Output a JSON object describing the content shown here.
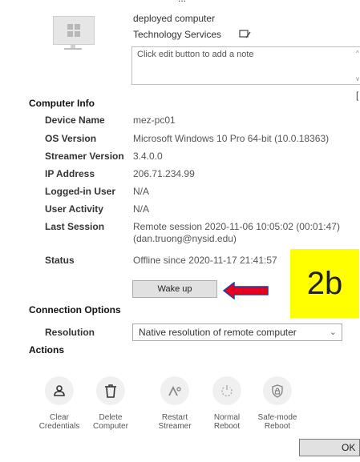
{
  "header": {
    "name_partial": "...",
    "description": "deployed computer",
    "group": "Technology Services",
    "note_placeholder": "Click edit button to add a note"
  },
  "computer_info": {
    "title": "Computer Info",
    "rows": [
      {
        "label": "Device Name",
        "value": "mez-pc01"
      },
      {
        "label": "OS Version",
        "value": "Microsoft Windows 10 Pro 64-bit (10.0.18363)"
      },
      {
        "label": "Streamer Version",
        "value": "3.4.0.0"
      },
      {
        "label": "IP Address",
        "value": "206.71.234.99"
      },
      {
        "label": "Logged-in User",
        "value": "N/A"
      },
      {
        "label": "User Activity",
        "value": "N/A"
      },
      {
        "label": "Last Session",
        "value": "Remote session 2020-11-06 10:05:02 (00:01:47)",
        "value2": "(dan.truong@nysid.edu)"
      },
      {
        "label": "Status",
        "value": "Offline since 2020-11-17 21:41:57"
      }
    ],
    "wake_button": "Wake up"
  },
  "annotation": {
    "badge": "2b",
    "arrow_color": "#e8001c"
  },
  "connection_options": {
    "title": "Connection Options",
    "resolution_label": "Resolution",
    "resolution_value": "Native resolution of remote computer"
  },
  "actions": {
    "title": "Actions",
    "items": [
      {
        "line1": "Clear",
        "line2": "Credentials",
        "icon": "person-icon"
      },
      {
        "line1": "Delete",
        "line2": "Computer",
        "icon": "trash-icon"
      },
      {
        "line1": "Restart",
        "line2": "Streamer",
        "icon": "restart-streamer-icon"
      },
      {
        "line1": "Normal",
        "line2": "Reboot",
        "icon": "reboot-icon"
      },
      {
        "line1": "Safe-mode",
        "line2": "Reboot",
        "icon": "shield-lock-icon"
      }
    ]
  },
  "footer": {
    "ok_label": "OK"
  }
}
